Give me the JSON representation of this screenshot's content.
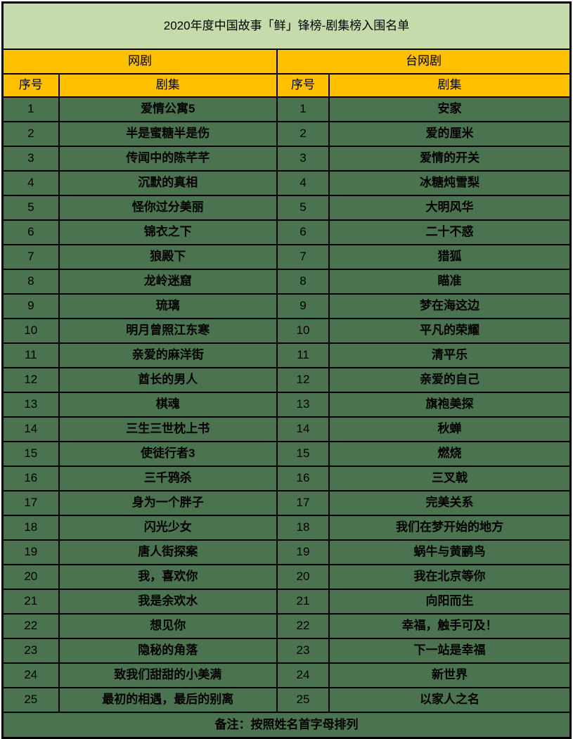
{
  "title": "2020年度中国故事「鲜」锋榜-剧集榜入围名单",
  "sections": {
    "left": "网剧",
    "right": "台网剧"
  },
  "columns": {
    "index": "序号",
    "show": "剧集"
  },
  "footer": "备注：按照姓名首字母排列",
  "colors": {
    "title_bg": "#c6dbac",
    "header_bg": "#ffc000",
    "body_bg": "#4c7350",
    "border": "#000000",
    "text": "#000000"
  },
  "rows": [
    {
      "left_no": "1",
      "left": "爱情公寓5",
      "right_no": "1",
      "right": "安家"
    },
    {
      "left_no": "2",
      "left": "半是蜜糖半是伤",
      "right_no": "2",
      "right": "爱的厘米"
    },
    {
      "left_no": "3",
      "left": "传闻中的陈芊芊",
      "right_no": "3",
      "right": "爱情的开关"
    },
    {
      "left_no": "4",
      "left": "沉默的真相",
      "right_no": "4",
      "right": "冰糖炖雪梨"
    },
    {
      "left_no": "5",
      "left": "怪你过分美丽",
      "right_no": "5",
      "right": "大明风华"
    },
    {
      "left_no": "6",
      "left": "锦衣之下",
      "right_no": "6",
      "right": "二十不惑"
    },
    {
      "left_no": "7",
      "left": "狼殿下",
      "right_no": "7",
      "right": "猎狐"
    },
    {
      "left_no": "8",
      "left": "龙岭迷窟",
      "right_no": "8",
      "right": "瞄准"
    },
    {
      "left_no": "9",
      "left": "琉璃",
      "right_no": "9",
      "right": "梦在海这边"
    },
    {
      "left_no": "10",
      "left": "明月曾照江东寒",
      "right_no": "10",
      "right": "平凡的荣耀"
    },
    {
      "left_no": "11",
      "left": "亲爱的麻洋街",
      "right_no": "11",
      "right": "清平乐"
    },
    {
      "left_no": "12",
      "left": "酋长的男人",
      "right_no": "12",
      "right": "亲爱的自己"
    },
    {
      "left_no": "13",
      "left": "棋魂",
      "right_no": "13",
      "right": "旗袍美探"
    },
    {
      "left_no": "14",
      "left": "三生三世枕上书",
      "right_no": "14",
      "right": "秋蝉"
    },
    {
      "left_no": "15",
      "left": "使徒行者3",
      "right_no": "15",
      "right": "燃烧"
    },
    {
      "left_no": "16",
      "left": "三千鸦杀",
      "right_no": "16",
      "right": "三叉戟"
    },
    {
      "left_no": "17",
      "left": "身为一个胖子",
      "right_no": "17",
      "right": "完美关系"
    },
    {
      "left_no": "18",
      "left": "闪光少女",
      "right_no": "18",
      "right": "我们在梦开始的地方"
    },
    {
      "left_no": "19",
      "left": "唐人街探案",
      "right_no": "19",
      "right": "蜗牛与黄鹂鸟"
    },
    {
      "left_no": "20",
      "left": "我，喜欢你",
      "right_no": "20",
      "right": "我在北京等你"
    },
    {
      "left_no": "21",
      "left": "我是余欢水",
      "right_no": "21",
      "right": "向阳而生"
    },
    {
      "left_no": "22",
      "left": "想见你",
      "right_no": "22",
      "right": "幸福，触手可及！"
    },
    {
      "left_no": "23",
      "left": "隐秘的角落",
      "right_no": "23",
      "right": "下一站是幸福"
    },
    {
      "left_no": "24",
      "left": "致我们甜甜的小美满",
      "right_no": "24",
      "right": "新世界"
    },
    {
      "left_no": "25",
      "left": "最初的相遇，最后的别离",
      "right_no": "25",
      "right": "以家人之名"
    }
  ]
}
